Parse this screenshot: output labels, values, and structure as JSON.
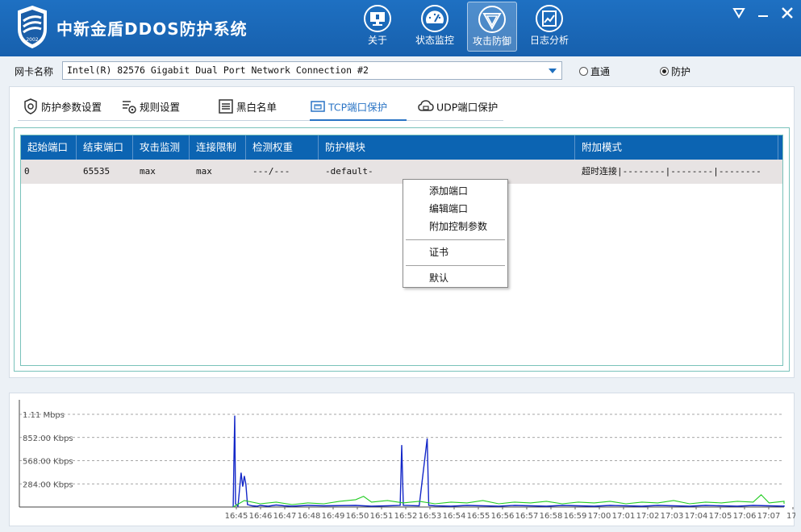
{
  "app": {
    "title": "中新金盾DDOS防护系统",
    "logo_text": "2002"
  },
  "nav": [
    {
      "label": "关于",
      "icon": "monitor-icon",
      "active": false
    },
    {
      "label": "状态监控",
      "icon": "gauge-icon",
      "active": false
    },
    {
      "label": "攻击防御",
      "icon": "shield-icon",
      "active": true
    },
    {
      "label": "日志分析",
      "icon": "chart-icon",
      "active": false
    }
  ],
  "nic": {
    "label": "网卡名称",
    "value": "Intel(R) 82576 Gigabit Dual Port Network Connection #2",
    "modes": [
      {
        "label": "直通",
        "selected": false
      },
      {
        "label": "防护",
        "selected": true
      }
    ]
  },
  "tabs": [
    {
      "label": "防护参数设置",
      "icon": "gear-shield-icon",
      "active": false
    },
    {
      "label": "规则设置",
      "icon": "rules-gear-icon",
      "active": false
    },
    {
      "label": "黑白名单",
      "icon": "list-icon",
      "active": false
    },
    {
      "label": "TCP端口保护",
      "icon": "network-port-icon",
      "active": true
    },
    {
      "label": "UDP端口保护",
      "icon": "cloud-icon",
      "active": false
    }
  ],
  "table": {
    "headers": [
      "起始端口",
      "结束端口",
      "攻击监测",
      "连接限制",
      "检测权重",
      "防护模块",
      "附加模式"
    ],
    "rows": [
      [
        "0",
        "65535",
        "max",
        "max",
        "---/---",
        "-default-",
        "超时连接|--------|--------|--------"
      ]
    ]
  },
  "context_menu": {
    "items": [
      "添加端口",
      "编辑端口",
      "附加控制参数"
    ],
    "items2": [
      "证书"
    ],
    "items3": [
      "默认"
    ]
  },
  "chart_data": {
    "type": "line",
    "title": "",
    "xlabel": "",
    "ylabel": "",
    "y_tick_labels": [
      "1.11 Mbps",
      "852.00 Kbps",
      "568.00 Kbps",
      "284.00 Kbps"
    ],
    "y_tick_values_kbps": [
      1136,
      852,
      568,
      284
    ],
    "ylim_kbps": [
      0,
      1136
    ],
    "x_tick_labels": [
      "16:45",
      "16:46",
      "16:47",
      "16:48",
      "16:49",
      "16:50",
      "16:51",
      "16:52",
      "16:53",
      "16:54",
      "16:55",
      "16:56",
      "16:57",
      "16:58",
      "16:59",
      "17:00",
      "17:01",
      "17:02",
      "17:03",
      "17:04",
      "17:05",
      "17:06",
      "17:07",
      "17:"
    ],
    "grid": "horizontal dashed",
    "series": [
      {
        "color": "#1428c8",
        "points": [
          [
            16.73,
            0
          ],
          [
            16.735,
            580
          ],
          [
            16.74,
            1120
          ],
          [
            16.745,
            40
          ],
          [
            16.76,
            10
          ],
          [
            16.78,
            420
          ],
          [
            16.79,
            250
          ],
          [
            16.8,
            380
          ],
          [
            16.81,
            280
          ],
          [
            16.82,
            30
          ],
          [
            16.85,
            15
          ],
          [
            16.88,
            10
          ],
          [
            16.9,
            20
          ],
          [
            16.95,
            10
          ],
          [
            17.0,
            25
          ],
          [
            17.05,
            15
          ],
          [
            17.1,
            10
          ],
          [
            17.2,
            20
          ],
          [
            17.3,
            15
          ],
          [
            17.5,
            20
          ],
          [
            17.6,
            10
          ],
          [
            17.7,
            15
          ],
          [
            17.78,
            20
          ],
          [
            17.79,
            760
          ],
          [
            17.8,
            20
          ],
          [
            17.9,
            15
          ],
          [
            17.95,
            840
          ],
          [
            17.96,
            20
          ],
          [
            18.0,
            15
          ],
          [
            18.1,
            10
          ],
          [
            18.2,
            20
          ],
          [
            18.3,
            15
          ],
          [
            18.4,
            10
          ],
          [
            18.5,
            20
          ],
          [
            18.6,
            15
          ],
          [
            18.7,
            10
          ],
          [
            18.8,
            20
          ],
          [
            18.9,
            15
          ],
          [
            19.0,
            10
          ],
          [
            19.1,
            20
          ],
          [
            19.2,
            15
          ],
          [
            19.3,
            10
          ],
          [
            19.4,
            20
          ],
          [
            19.5,
            15
          ],
          [
            19.6,
            10
          ],
          [
            19.7,
            20
          ],
          [
            19.8,
            15
          ],
          [
            19.9,
            10
          ],
          [
            20.0,
            20
          ],
          [
            20.1,
            15
          ],
          [
            20.2,
            10
          ],
          [
            20.25,
            20
          ]
        ]
      },
      {
        "color": "#22cc22",
        "points": [
          [
            16.73,
            0
          ],
          [
            16.8,
            80
          ],
          [
            16.9,
            40
          ],
          [
            17.0,
            60
          ],
          [
            17.1,
            30
          ],
          [
            17.2,
            50
          ],
          [
            17.3,
            40
          ],
          [
            17.4,
            70
          ],
          [
            17.5,
            90
          ],
          [
            17.55,
            130
          ],
          [
            17.6,
            60
          ],
          [
            17.7,
            80
          ],
          [
            17.8,
            50
          ],
          [
            17.9,
            70
          ],
          [
            18.0,
            40
          ],
          [
            18.1,
            60
          ],
          [
            18.2,
            50
          ],
          [
            18.3,
            80
          ],
          [
            18.4,
            40
          ],
          [
            18.5,
            60
          ],
          [
            18.6,
            50
          ],
          [
            18.7,
            70
          ],
          [
            18.8,
            40
          ],
          [
            18.9,
            60
          ],
          [
            19.0,
            50
          ],
          [
            19.1,
            70
          ],
          [
            19.2,
            40
          ],
          [
            19.3,
            60
          ],
          [
            19.4,
            50
          ],
          [
            19.5,
            80
          ],
          [
            19.6,
            40
          ],
          [
            19.7,
            60
          ],
          [
            19.8,
            50
          ],
          [
            19.9,
            70
          ],
          [
            20.0,
            60
          ],
          [
            20.05,
            150
          ],
          [
            20.1,
            50
          ],
          [
            20.2,
            70
          ],
          [
            20.25,
            40
          ]
        ]
      }
    ]
  }
}
